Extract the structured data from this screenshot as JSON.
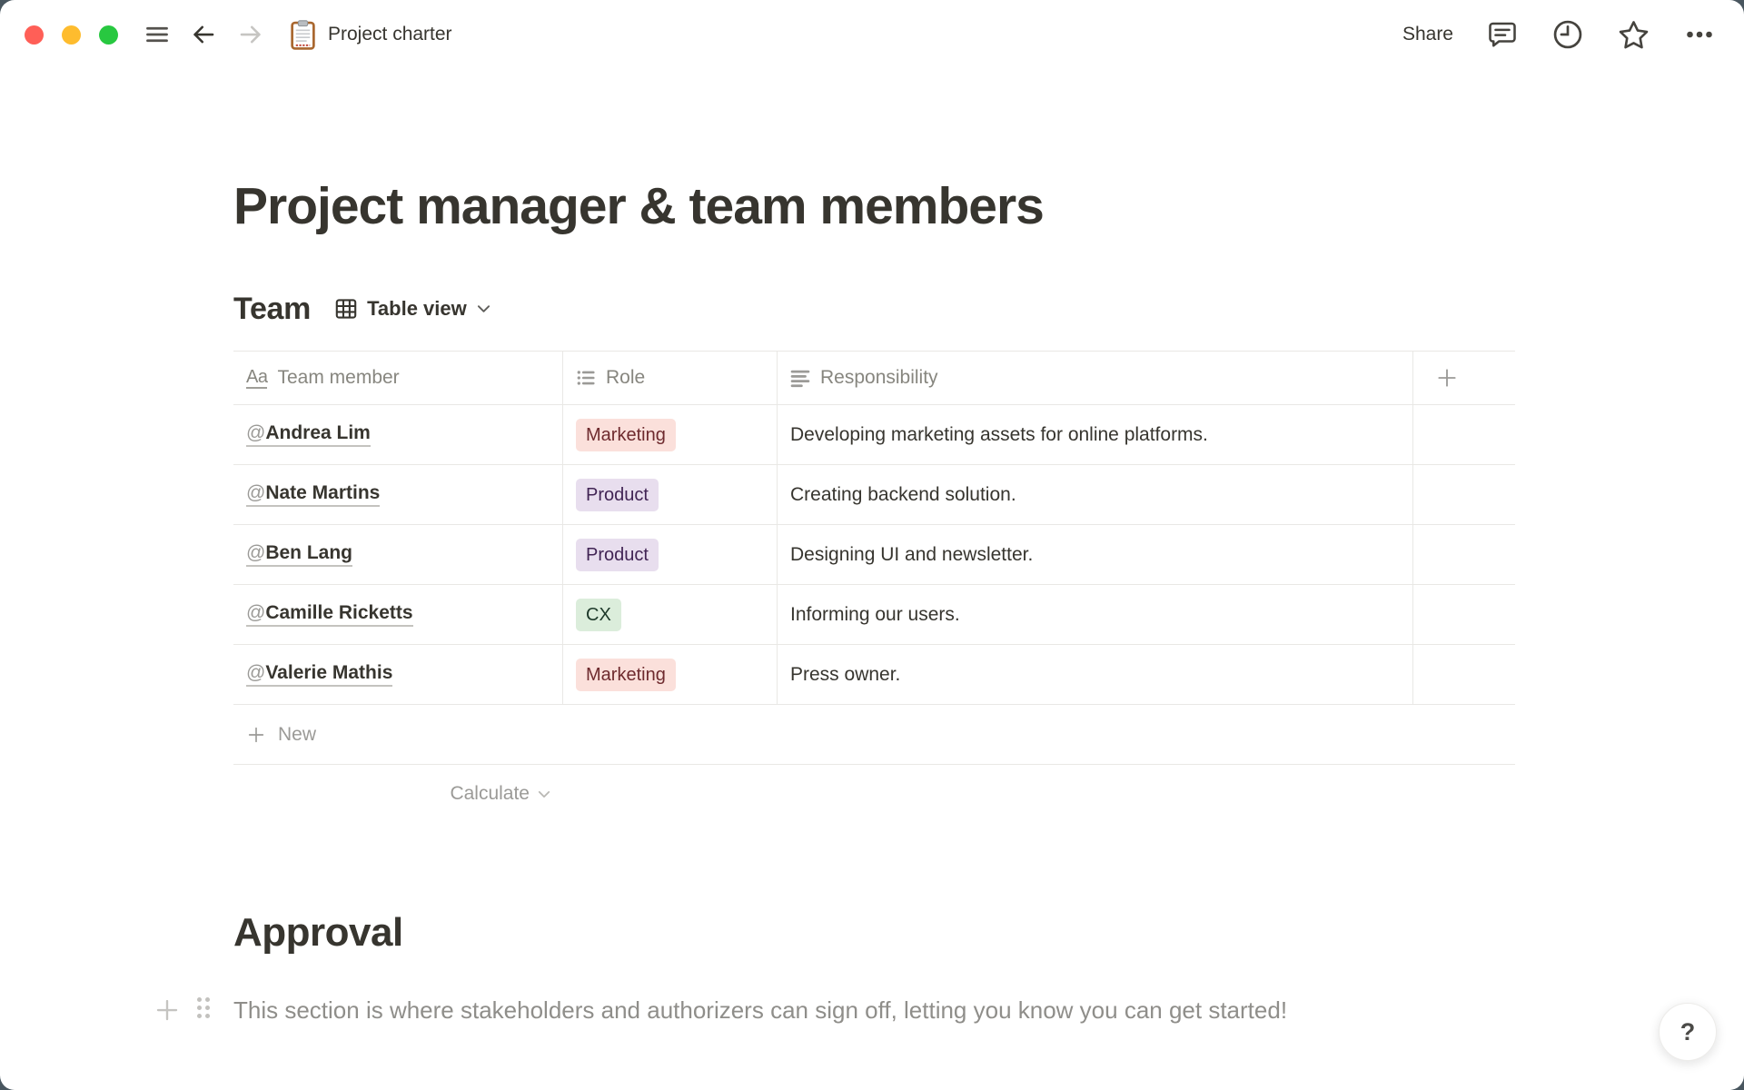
{
  "titlebar": {
    "title": "Project charter",
    "share_label": "Share",
    "icons_left": [
      "hamburger-menu-icon",
      "back-arrow-icon",
      "forward-arrow-icon",
      "clipboard-page-icon"
    ],
    "icons_right": [
      "comments-icon",
      "updates-clock-icon",
      "favorite-star-icon",
      "more-options-icon"
    ],
    "traffic_lights": {
      "close": "#FF5F57",
      "minimize": "#FEBC2E",
      "zoom": "#28C840"
    }
  },
  "page": {
    "title": "Project manager & team members",
    "database": {
      "title": "Team",
      "view_label": "Table view",
      "view_icon": "table-view-icon",
      "mention_prefix": "@",
      "columns": [
        {
          "label": "Team member",
          "icon": "title-property-icon",
          "icon_glyph": "Aa"
        },
        {
          "label": "Role",
          "icon": "select-property-icon"
        },
        {
          "label": "Responsibility",
          "icon": "text-property-icon"
        }
      ],
      "add_column_icon": "plus-icon",
      "rows": [
        {
          "name": "Andrea Lim",
          "role": "Marketing",
          "role_color": "red",
          "responsibility": "Developing marketing assets for online platforms."
        },
        {
          "name": "Nate Martins",
          "role": "Product",
          "role_color": "purple",
          "responsibility": "Creating backend solution."
        },
        {
          "name": "Ben Lang",
          "role": "Product",
          "role_color": "purple",
          "responsibility": "Designing UI and newsletter."
        },
        {
          "name": "Camille Ricketts",
          "role": "CX",
          "role_color": "green",
          "responsibility": "Informing our users."
        },
        {
          "name": "Valerie Mathis",
          "role": "Marketing",
          "role_color": "red",
          "responsibility": "Press owner."
        }
      ],
      "new_row_label": "New",
      "calculate_label": "Calculate"
    },
    "sections": {
      "approval_heading": "Approval",
      "approval_body": "This section is where stakeholders and authorizers can sign off, letting you know you can get started!"
    },
    "help_button_label": "?"
  },
  "colors": {
    "text": "#37352F",
    "secondary_text": "#87867F",
    "faint_text": "#9B9A97",
    "divider": "#E9E8E5",
    "backdrop": "#49565F",
    "tags": {
      "red": {
        "bg": "#FBE0DB",
        "text": "#6E2A2E"
      },
      "purple": {
        "bg": "#E8DEEE",
        "text": "#412454"
      },
      "green": {
        "bg": "#DBEDDB",
        "text": "#1C3829"
      }
    }
  }
}
